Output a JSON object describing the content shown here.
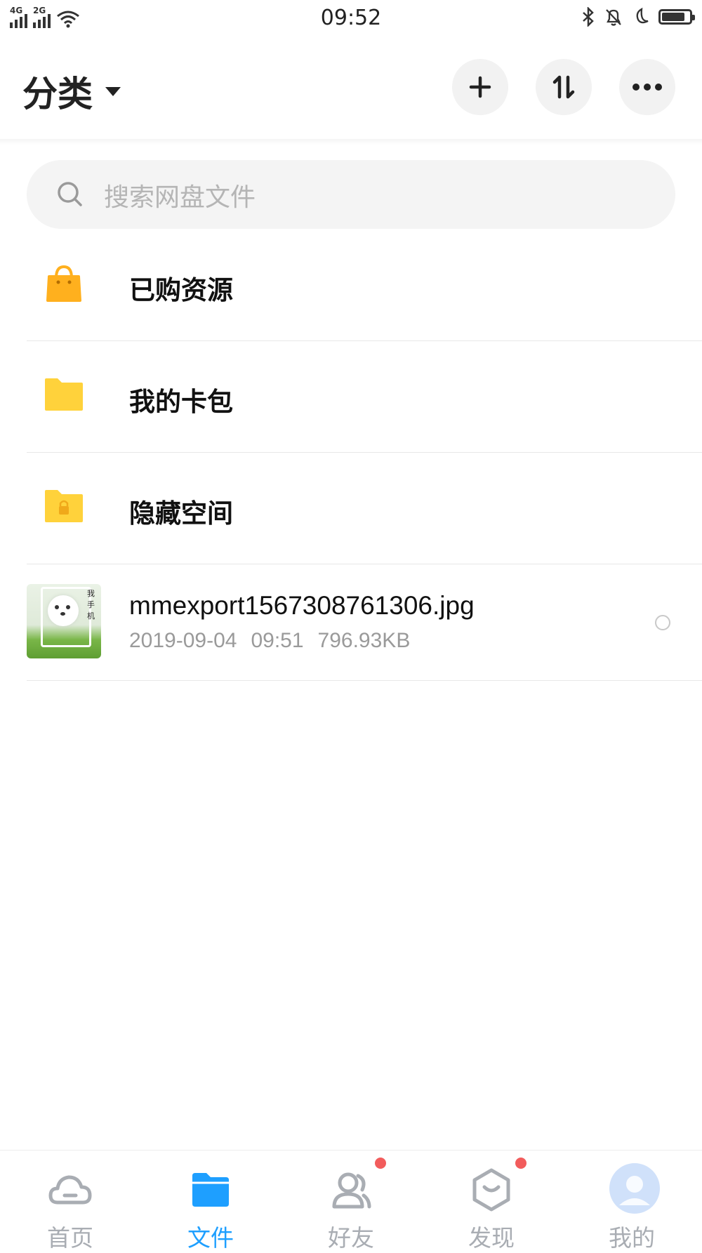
{
  "status_bar": {
    "network1": "4G",
    "network2": "2G",
    "time": "09:52",
    "battery_level": 0.85
  },
  "header": {
    "title": "分类",
    "actions": [
      "plus-icon",
      "sort-icon",
      "more-icon"
    ]
  },
  "search": {
    "placeholder": "搜索网盘文件"
  },
  "list": {
    "items": [
      {
        "label": "已购资源",
        "icon": "shopping-bag-icon",
        "color": "#FFB01E"
      },
      {
        "label": "我的卡包",
        "icon": "folder-icon",
        "color": "#FFD23B"
      },
      {
        "label": "隐藏空间",
        "icon": "locked-folder-icon",
        "color": "#FFD23B"
      }
    ],
    "file": {
      "name": "mmexport1567308761306.jpg",
      "date": "2019-09-04",
      "time": "09:51",
      "size": "796.93KB",
      "thumbnail_text": "我手机"
    }
  },
  "bottom_nav": {
    "tabs": [
      {
        "label": "首页",
        "icon": "cloud-icon",
        "active": false,
        "badge": false
      },
      {
        "label": "文件",
        "icon": "folder-icon",
        "active": true,
        "badge": false
      },
      {
        "label": "好友",
        "icon": "friends-icon",
        "active": false,
        "badge": true
      },
      {
        "label": "发现",
        "icon": "discover-icon",
        "active": false,
        "badge": true
      },
      {
        "label": "我的",
        "icon": "profile-icon",
        "active": false,
        "badge": false
      }
    ]
  },
  "colors": {
    "accent": "#1E9FFF",
    "badge": "#F25C5C",
    "search_bg": "#F4F4F4",
    "muted_text": "#9A9A9A"
  }
}
